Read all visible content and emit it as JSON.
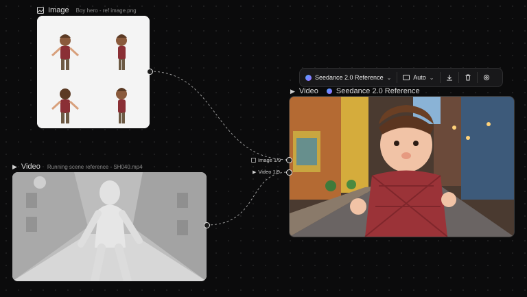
{
  "image_node": {
    "title": "Image",
    "filename": "Boy hero - ref image.png",
    "icon": "image-icon"
  },
  "video_node": {
    "title": "Video",
    "filename": "Running scene reference - SH040.mp4",
    "icon": "play-icon"
  },
  "output_node": {
    "title": "Video",
    "model": "Seedance 2.0 Reference",
    "icon": "play-icon"
  },
  "toolbar": {
    "model": "Seedance 2.0 Reference",
    "aspect": "Auto",
    "icons": [
      "seedance-logo-icon",
      "chevron-down-icon",
      "aspect-ratio-icon",
      "download-icon",
      "trash-icon",
      "settings-icon"
    ]
  },
  "inputs": {
    "image": "Image 1/9",
    "video": "Video 1/9"
  },
  "colors": {
    "background": "#0b0b0c",
    "accent": "#4aa3ff"
  }
}
